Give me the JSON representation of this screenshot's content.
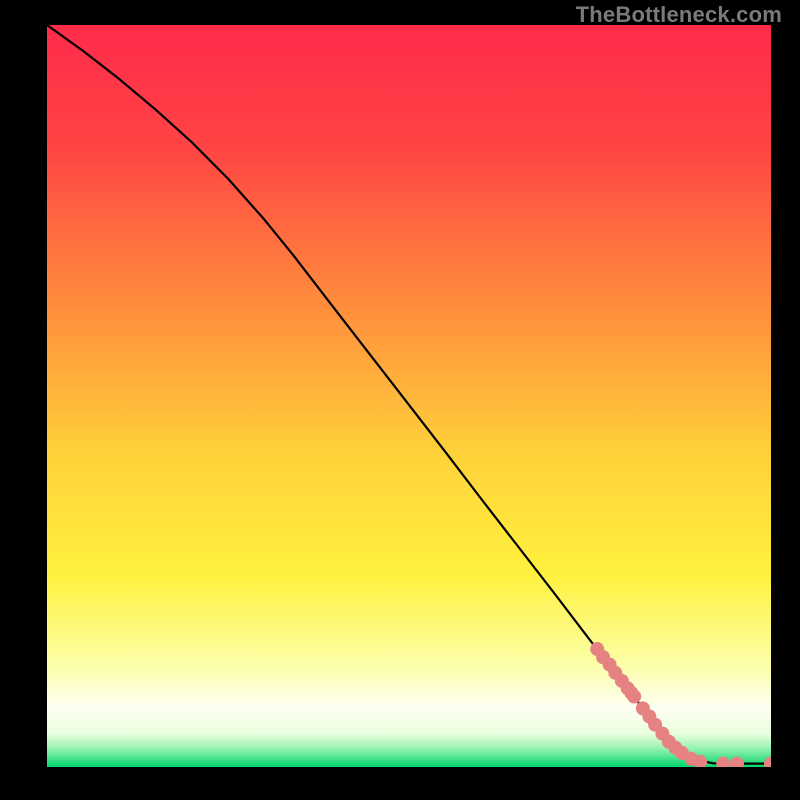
{
  "attribution": "TheBottleneck.com",
  "colors": {
    "background": "#000000",
    "line": "#000000",
    "marker": "#e68282",
    "gradient_top": "#ff2b4a",
    "gradient_mid": "#ffe23a",
    "gradient_bottom_band_top": "#f9ffc8",
    "gradient_bottom_band_mid": "#fefff0",
    "gradient_bottom": "#00d66a"
  },
  "chart_data": {
    "type": "line",
    "title": "",
    "xlabel": "",
    "ylabel": "",
    "xlim": [
      0,
      100
    ],
    "ylim": [
      0,
      100
    ],
    "series": [
      {
        "name": "curve",
        "x": [
          0,
          5,
          10,
          15,
          20,
          25,
          30,
          34,
          40,
          45,
          50,
          55,
          60,
          65,
          70,
          75,
          80,
          82,
          84,
          86,
          88,
          90,
          92,
          94,
          96,
          98,
          100
        ],
        "y": [
          100,
          96.5,
          92.7,
          88.6,
          84.2,
          79.3,
          73.8,
          69.0,
          61.4,
          55.1,
          48.8,
          42.5,
          36.1,
          29.8,
          23.5,
          17.1,
          10.8,
          8.3,
          5.8,
          3.5,
          1.8,
          0.9,
          0.5,
          0.45,
          0.45,
          0.45,
          0.45
        ]
      }
    ],
    "markers": {
      "name": "highlight-points",
      "x": [
        76.0,
        76.8,
        77.7,
        78.5,
        79.4,
        80.2,
        80.7,
        81.1,
        82.3,
        83.2,
        84.0,
        85.0,
        85.9,
        86.8,
        87.7,
        89.0,
        90.2,
        93.4,
        95.3,
        100.0
      ],
      "y": [
        15.9,
        14.8,
        13.8,
        12.7,
        11.6,
        10.6,
        10.0,
        9.5,
        7.9,
        6.8,
        5.7,
        4.5,
        3.4,
        2.6,
        1.9,
        1.1,
        0.7,
        0.45,
        0.45,
        0.45
      ]
    }
  }
}
